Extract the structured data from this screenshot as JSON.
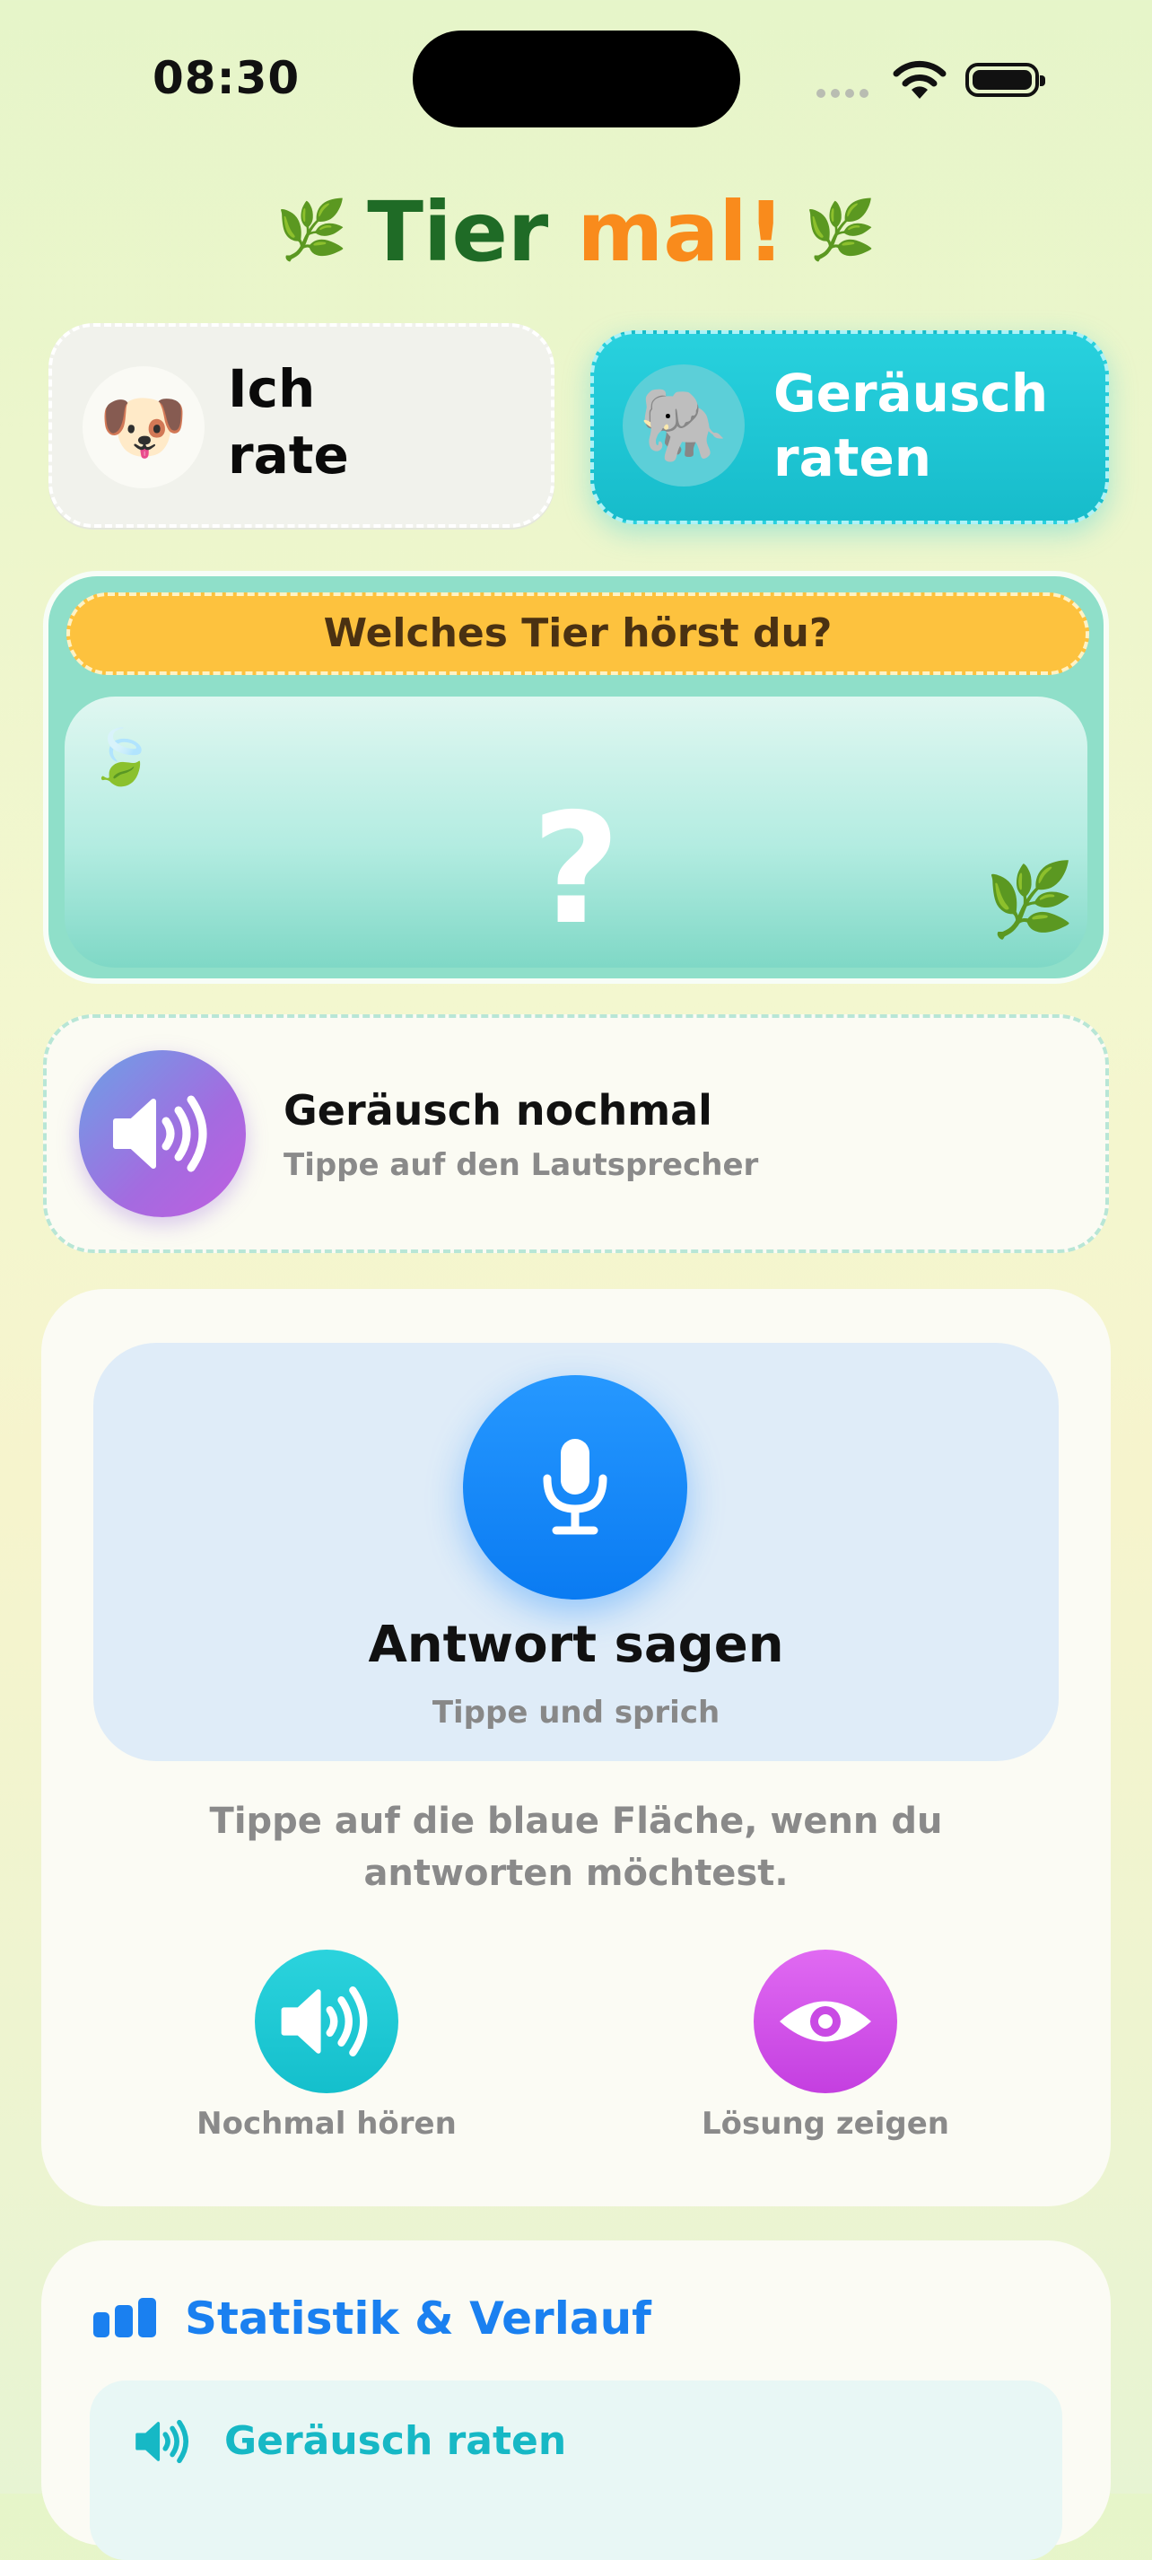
{
  "status_bar": {
    "time": "08:30"
  },
  "title": {
    "part1": "Tier",
    "part2": "mal!",
    "leaf_glyph": "🌿"
  },
  "modes": [
    {
      "emoji": "🐶",
      "label_line1": "Ich",
      "label_line2": "rate",
      "selected": false
    },
    {
      "emoji": "🐘",
      "label_line1": "Geräusch",
      "label_line2": "raten",
      "selected": true
    }
  ],
  "question": {
    "banner": "Welches Tier hörst du?",
    "placeholder": "?",
    "leaf_top": "🍃",
    "leaf_bottom": "🌿"
  },
  "replay": {
    "title": "Geräusch nochmal",
    "subtitle": "Tippe auf den Lautsprecher",
    "icon": "speaker-wave-icon"
  },
  "answer": {
    "title": "Antwort sagen",
    "subtitle": "Tippe und sprich",
    "hint": "Tippe auf die blaue Fläche, wenn du antworten möchtest.",
    "icon": "microphone-icon"
  },
  "actions": [
    {
      "label": "Nochmal hören",
      "icon": "speaker-wave-icon",
      "color": "#1cc6d2"
    },
    {
      "label": "Lösung zeigen",
      "icon": "eye-icon",
      "color": "#d052e8"
    }
  ],
  "stats": {
    "title": "Statistik & Verlauf",
    "row_label": "Geräusch raten",
    "accent": "#1a80f0"
  }
}
